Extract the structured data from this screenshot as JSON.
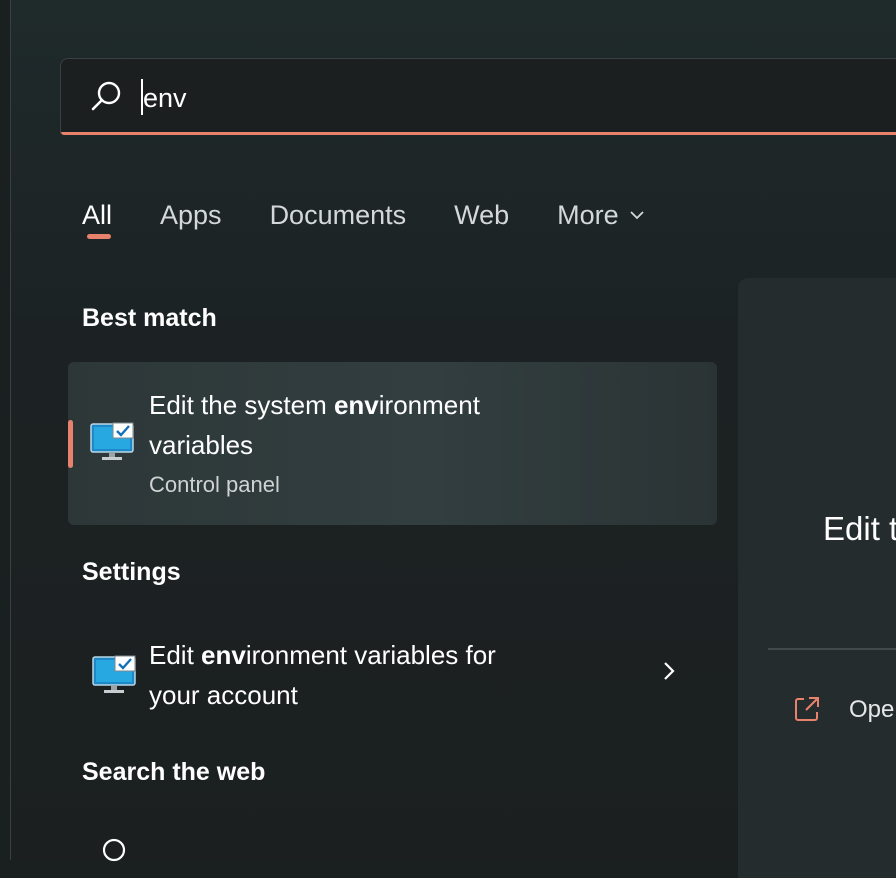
{
  "search": {
    "query": "env"
  },
  "tabs": [
    {
      "label": "All",
      "active": true
    },
    {
      "label": "Apps",
      "active": false
    },
    {
      "label": "Documents",
      "active": false
    },
    {
      "label": "Web",
      "active": false
    },
    {
      "label": "More",
      "active": false
    }
  ],
  "sections": {
    "best_match": "Best match",
    "settings": "Settings",
    "search_web": "Search the web"
  },
  "best_match": {
    "title_prefix": "Edit the system ",
    "title_bold": "env",
    "title_suffix": "ironment",
    "title_line2": "variables",
    "subtitle": "Control panel",
    "icon": "control-panel-monitor-icon"
  },
  "settings_result": {
    "title_prefix": "Edit ",
    "title_bold": "env",
    "title_suffix": "ironment variables for",
    "title_line2": "your account",
    "icon": "control-panel-monitor-icon"
  },
  "preview": {
    "title": "Edit t",
    "open_label": "Ope"
  },
  "colors": {
    "accent": "#e8826c",
    "background": "#1c2223"
  }
}
